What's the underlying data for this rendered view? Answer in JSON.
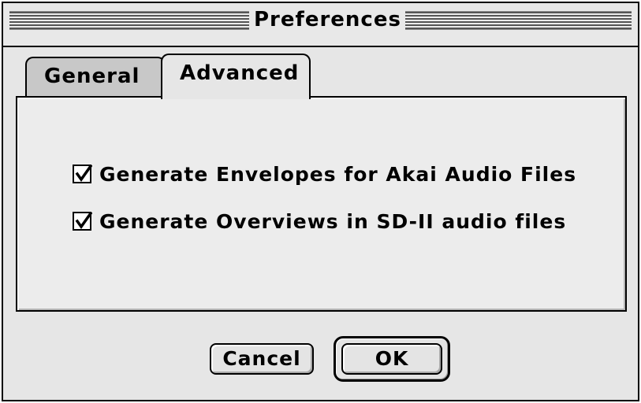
{
  "window": {
    "title": "Preferences"
  },
  "tabs": [
    {
      "label": "General",
      "selected": false
    },
    {
      "label": "Advanced",
      "selected": true
    }
  ],
  "options": [
    {
      "label": "Generate Envelopes for Akai Audio Files",
      "checked": true
    },
    {
      "label": "Generate Overviews in SD-II audio files",
      "checked": true
    }
  ],
  "buttons": {
    "cancel_label": "Cancel",
    "ok_label": "OK"
  }
}
